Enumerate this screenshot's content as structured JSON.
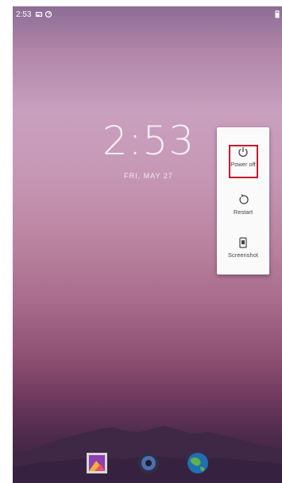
{
  "status_bar": {
    "time": "2:53",
    "icons": [
      "image-icon",
      "sync-icon",
      "battery-icon"
    ]
  },
  "lock_screen": {
    "clock": "2:53",
    "date": "FRI, MAY 27"
  },
  "power_menu": {
    "items": [
      {
        "label": "Power off",
        "icon": "power-icon"
      },
      {
        "label": "Restart",
        "icon": "restart-icon"
      },
      {
        "label": "Screenshot",
        "icon": "screenshot-icon"
      }
    ],
    "highlighted": "Power off",
    "highlight_color": "#c8102e"
  },
  "dock": {
    "apps": [
      "gallery-icon",
      "music-icon",
      "browser-icon"
    ]
  }
}
